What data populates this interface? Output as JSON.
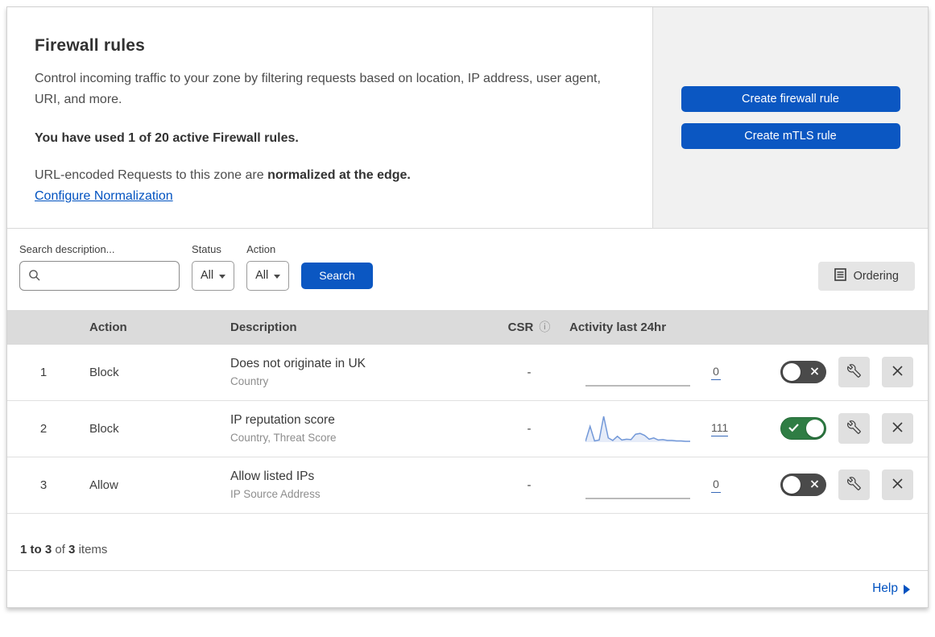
{
  "header": {
    "title": "Firewall rules",
    "description": "Control incoming traffic to your zone by filtering requests based on location, IP address, user agent, URI, and more.",
    "usage": "You have used 1 of 20 active Firewall rules.",
    "normalization_prefix": "URL-encoded Requests to this zone are ",
    "normalization_bold": "normalized at the edge.",
    "normalization_link": "Configure Normalization",
    "create_firewall_button": "Create firewall rule",
    "create_mtls_button": "Create mTLS rule"
  },
  "filters": {
    "search_label": "Search description...",
    "search_value": "",
    "status_label": "Status",
    "status_value": "All",
    "action_label": "Action",
    "action_value": "All",
    "search_button": "Search",
    "ordering_button": "Ordering"
  },
  "table": {
    "columns": {
      "action": "Action",
      "description": "Description",
      "csr": "CSR",
      "activity": "Activity last 24hr"
    },
    "rows": [
      {
        "priority": "1",
        "action": "Block",
        "description": "Does not originate in UK",
        "fields": "Country",
        "csr": "-",
        "count": "0",
        "enabled": false,
        "sparkline": [
          0,
          0
        ]
      },
      {
        "priority": "2",
        "action": "Block",
        "description": "IP reputation score",
        "fields": "Country, Threat Score",
        "csr": "-",
        "count": "111",
        "enabled": true,
        "sparkline": [
          2,
          38,
          3,
          5,
          62,
          10,
          4,
          14,
          5,
          7,
          6,
          19,
          21,
          16,
          7,
          10,
          5,
          6,
          4,
          4,
          3,
          3,
          2,
          2
        ]
      },
      {
        "priority": "3",
        "action": "Allow",
        "description": "Allow listed IPs",
        "fields": "IP Source Address",
        "csr": "-",
        "count": "0",
        "enabled": false,
        "sparkline": [
          0,
          0
        ]
      }
    ]
  },
  "footer": {
    "range": "1 to 3",
    "of_text": "of",
    "total": "3",
    "items_text": "items",
    "help_label": "Help"
  },
  "colors": {
    "accent_blue": "#0b57c2",
    "link_blue": "#0052c0",
    "toggle_on_green": "#2f7d44",
    "toggle_off_gray": "#4a4a4a",
    "sparkline_blue": "#7298d8",
    "table_header_gray": "#dbdbdb",
    "panel_gray": "#f1f1f1"
  }
}
